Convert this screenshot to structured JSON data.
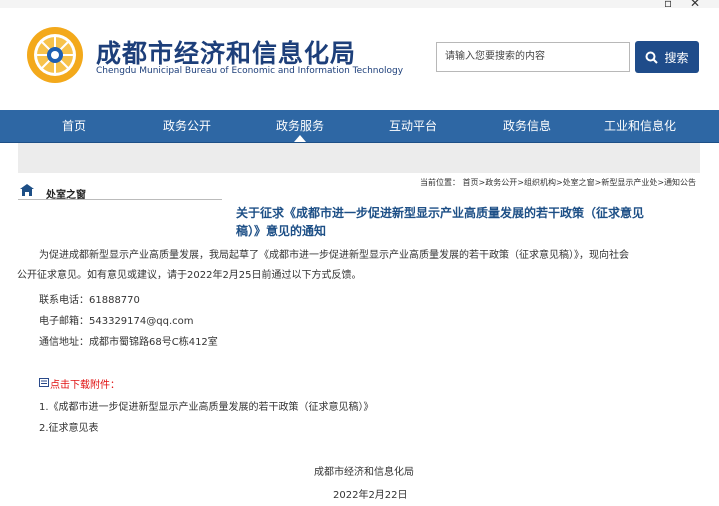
{
  "header": {
    "title_cn": "成都市经济和信息化局",
    "title_en": "Chengdu Municipal Bureau of Economic and Information Technology",
    "search_placeholder": "请输入您要搜索的内容",
    "search_button": "搜索"
  },
  "nav": {
    "items": [
      "首页",
      "政务公开",
      "政务服务",
      "互动平台",
      "政务信息",
      "工业和信息化"
    ],
    "active": "政务服务"
  },
  "breadcrumb": "当前位置： 首页>政务公开>组织机构>处室之窗>新型显示产业处>通知公告",
  "sidebar": {
    "label": "处室之窗"
  },
  "article": {
    "title_line1": "关于征求《成都市进一步促进新型显示产业高质量发展的若干政策（征求意见",
    "title_line2": "稿）》意见的通知",
    "intro_line1": "为促进成都新型显示产业高质量发展，我局起草了《成都市进一步促进新型显示产业高质量发展的若干政策（征求意见稿）》，现向社会",
    "intro_line2": "公开征求意见。如有意见或建议，请于2022年2月25日前通过以下方式反馈。",
    "phone": "联系电话：61888770",
    "email": "电子邮箱：543329174@qq.com",
    "address": "通信地址：成都市蜀锦路68号C栋412室",
    "download_label": "点击下载附件：",
    "attachment_1": "1.《成都市进一步促进新型显示产业高质量发展的若干政策（征求意见稿）》",
    "attachment_2": "2.征求意见表",
    "signature": "成都市经济和信息化局",
    "date": "2022年2月22日"
  },
  "colors": {
    "brand_blue": "#1d3f7a",
    "nav_blue": "#2e67a4",
    "title_blue": "#1d4f86",
    "download_red": "#e01010"
  },
  "icons": [
    "logo-emblem",
    "search-icon",
    "sidebar-heading-icon",
    "attachment-icon"
  ]
}
